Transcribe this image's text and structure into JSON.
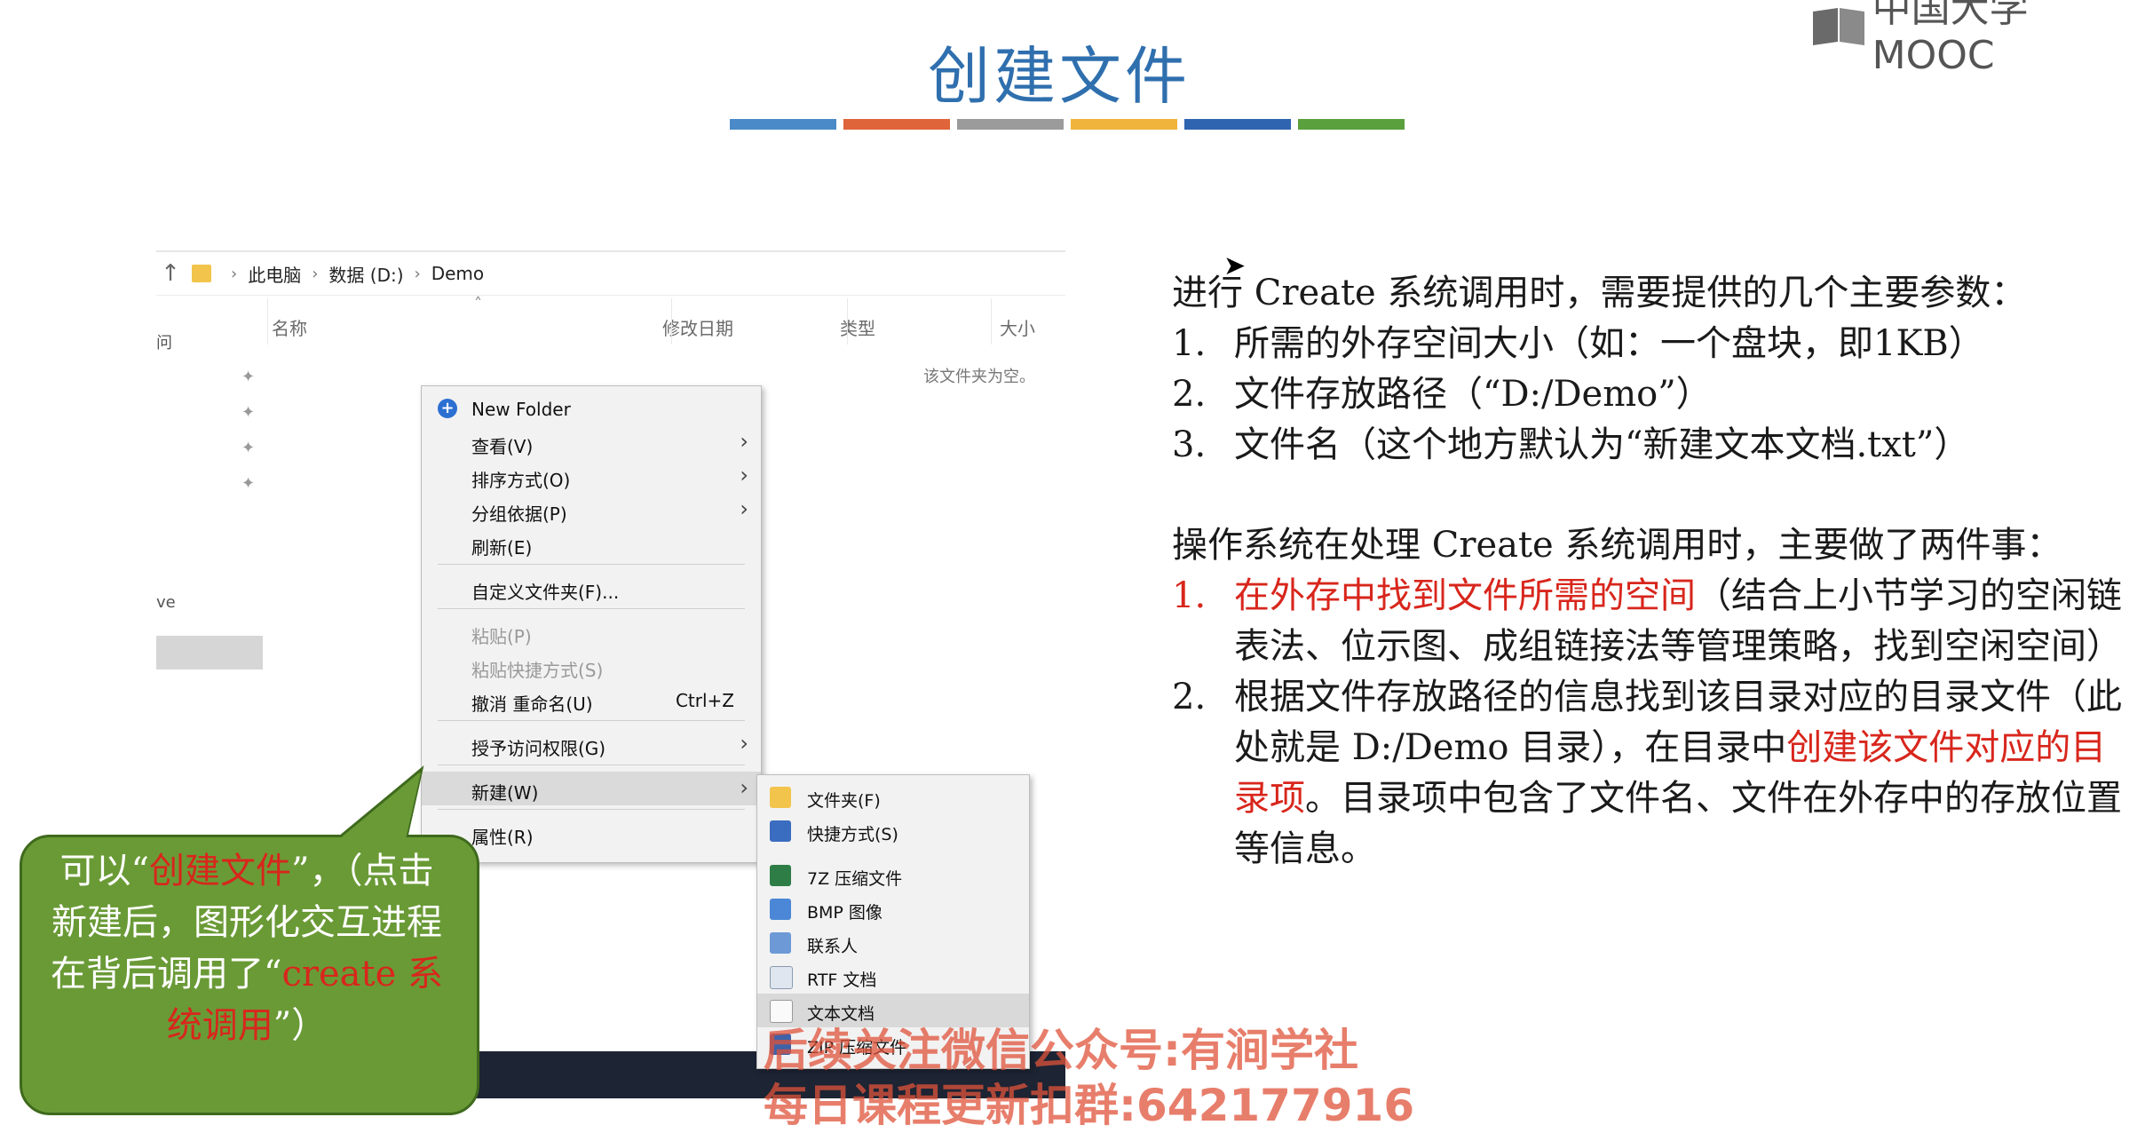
{
  "slide": {
    "title": "创建文件",
    "color_bar": [
      "#4a8ac8",
      "#e0643a",
      "#9b9b9b",
      "#f0b43c",
      "#2f64b0",
      "#5aa03c"
    ],
    "logo": "中国大学MOOC"
  },
  "explorer": {
    "breadcrumb": [
      "此电脑",
      "数据 (D:)",
      "Demo"
    ],
    "columns": [
      "名称",
      "修改日期",
      "类型",
      "大小"
    ],
    "empty_message": "该文件夹为空。",
    "left_pane": [
      "问",
      "ve"
    ]
  },
  "context_menu": {
    "items": [
      {
        "label": "New Folder",
        "icon": "add-circle-icon"
      },
      {
        "label": "查看(V)",
        "submenu": true
      },
      {
        "label": "排序方式(O)",
        "submenu": true
      },
      {
        "label": "分组依据(P)",
        "submenu": true
      },
      {
        "label": "刷新(E)"
      },
      {
        "label": "自定义文件夹(F)..."
      },
      {
        "label": "粘贴(P)",
        "disabled": true
      },
      {
        "label": "粘贴快捷方式(S)",
        "disabled": true
      },
      {
        "label": "撤消 重命名(U)",
        "shortcut": "Ctrl+Z"
      },
      {
        "label": "授予访问权限(G)",
        "submenu": true
      },
      {
        "label": "新建(W)",
        "submenu": true,
        "highlighted": true
      },
      {
        "label": "属性(R)"
      }
    ]
  },
  "new_submenu": {
    "items": [
      {
        "label": "文件夹(F)",
        "icon": "folder-icon"
      },
      {
        "label": "快捷方式(S)",
        "icon": "shortcut-icon"
      },
      {
        "label": "7Z 压缩文件",
        "icon": "archive-7z-icon"
      },
      {
        "label": "BMP 图像",
        "icon": "bmp-image-icon"
      },
      {
        "label": "联系人",
        "icon": "contact-icon"
      },
      {
        "label": "RTF 文档",
        "icon": "rtf-document-icon"
      },
      {
        "label": "文本文档",
        "icon": "text-document-icon",
        "highlighted": true
      },
      {
        "label": "ZIP 压缩文件",
        "icon": "zip-archive-icon"
      }
    ]
  },
  "callout": {
    "part1": "可以“",
    "part2": "创建文件",
    "part3": "”，（点击新建后，图形化交互进程在背后调用了“",
    "part4": "create 系统调用",
    "part5": "”）"
  },
  "notes": {
    "intro": "进行 Create 系统调用时，需要提供的几个主要参数：",
    "params": [
      {
        "num": "1.",
        "text": "所需的外存空间大小（如：一个盘块，即1KB）"
      },
      {
        "num": "2.",
        "text": "文件存放路径（“D:/Demo”）"
      },
      {
        "num": "3.",
        "text": "文件名（这个地方默认为“新建文本文档.txt”）"
      }
    ],
    "intro2": "操作系统在处理 Create 系统调用时，主要做了两件事：",
    "step1_num": "1.",
    "step1_red": "在外存中找到文件所需的空间",
    "step1_rest": "（结合上小节学习的空闲链表法、位示图、成组链接法等管理策略，找到空闲空间）",
    "step2_num": "2.",
    "step2_a": "根据文件存放路径的信息找到该目录对应的目录文件（此处就是 D:/Demo 目录），在目录中",
    "step2_red": "创建该文件对应的目录项",
    "step2_b": "。目录项中包含了文件名、文件在外存中的存放位置等信息。"
  },
  "watermark": {
    "line1": "后续关注微信公众号:有涧学社",
    "line2": "每日课程更新扣群:642177916"
  }
}
